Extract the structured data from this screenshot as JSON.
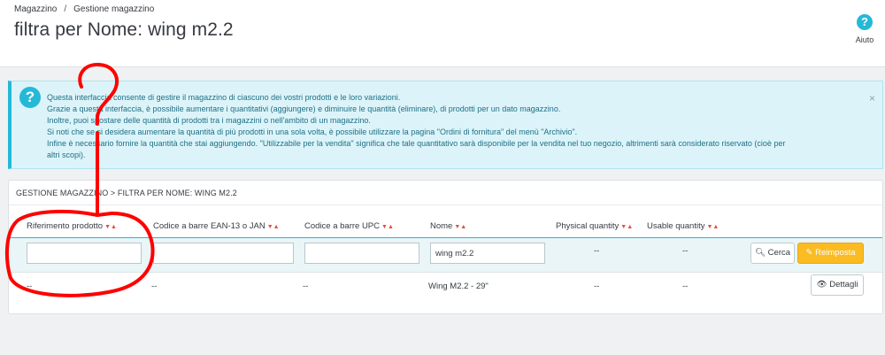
{
  "breadcrumb": {
    "root": "Magazzino",
    "separator": "/",
    "current": "Gestione magazzino"
  },
  "page_title": "filtra per Nome: wing m2.2",
  "help": {
    "label": "Aiuto",
    "icon": "question-circle-icon",
    "glyph": "?"
  },
  "info_alert": {
    "icon": "question-circle-icon",
    "icon_glyph": "?",
    "close_glyph": "×",
    "lines": [
      "Questa interfaccia consente di gestire il magazzino di ciascuno dei vostri prodotti e le loro variazioni.",
      "Grazie a questa interfaccia, è possibile aumentare i quantitativi (aggiungere) e diminuire le quantità (eliminare), di prodotti per un dato magazzino.",
      "Inoltre, puoi spostare delle quantità di prodotti tra i magazzini o nell'ambito di un magazzino.",
      "Si noti che se si desidera aumentare la quantità di più prodotti in una sola volta, è possibile utilizzare la pagina \"Ordini di fornitura\" del menù \"Archivio\".",
      "Infine è necessario fornire la quantità che stai aggiungendo. \"Utilizzabile per la vendita\" significa che tale quantitativo sarà disponibile per la vendita nel tuo negozio, altrimenti sarà considerato riservato (cioè per",
      "altri scopi)."
    ]
  },
  "panel": {
    "heading": "GESTIONE MAGAZZINO > FILTRA PER NOME: WING M2.2",
    "sort_glyph": "▼▲",
    "columns": [
      "Riferimento prodotto",
      "Codice a barre EAN-13 o JAN",
      "Codice a barre UPC",
      "Nome",
      "Physical quantity",
      "Usable quantity"
    ],
    "filters": {
      "reference": "",
      "ean13": "",
      "upc": "",
      "name": "wing m2.2",
      "physical": "--",
      "usable": "--"
    },
    "buttons": {
      "search": "Cerca",
      "reset": "Reimposta",
      "details": "Dettagli"
    },
    "rows": [
      {
        "reference": "--",
        "ean13": "--",
        "upc": "--",
        "name": "Wing M2.2 - 29\"",
        "physical": "--",
        "usable": "--"
      }
    ]
  },
  "annotation": {
    "glyph": "?",
    "color": "#ff0000"
  }
}
